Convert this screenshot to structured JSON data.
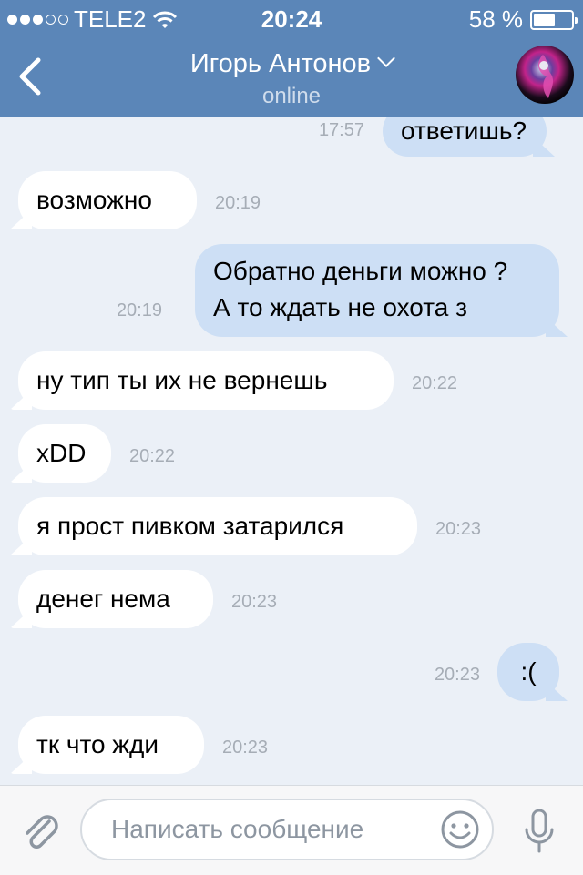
{
  "status_bar": {
    "carrier": "TELE2",
    "signal_filled": 3,
    "signal_total": 5,
    "time": "20:24",
    "battery_text": "58 %",
    "battery_level": 0.58
  },
  "header": {
    "title": "Игорь Антонов",
    "subtitle": "online",
    "accent_color": "#5b86b8"
  },
  "messages": [
    {
      "dir": "out",
      "text": "ответишь?",
      "time": "17:57"
    },
    {
      "dir": "in",
      "text": "возможно",
      "time": "20:19"
    },
    {
      "dir": "out",
      "lines": [
        "Обратно деньги можно ?",
        "А то ждать не охота з"
      ],
      "time": "20:19"
    },
    {
      "dir": "in",
      "text": "ну тип ты их не вернешь",
      "time": "20:22"
    },
    {
      "dir": "in",
      "text": "xDD",
      "time": "20:22"
    },
    {
      "dir": "in",
      "text": "я прост пивком затарился",
      "time": "20:23"
    },
    {
      "dir": "in",
      "text": "денег нема",
      "time": "20:23"
    },
    {
      "dir": "out",
      "text": ":(",
      "time": "20:23"
    },
    {
      "dir": "in",
      "text": "тк что жди",
      "time": "20:23"
    }
  ],
  "composer": {
    "placeholder": "Написать сообщение",
    "attach_icon": "paperclip-icon",
    "emoji_icon": "smiley-icon",
    "mic_icon": "microphone-icon"
  }
}
